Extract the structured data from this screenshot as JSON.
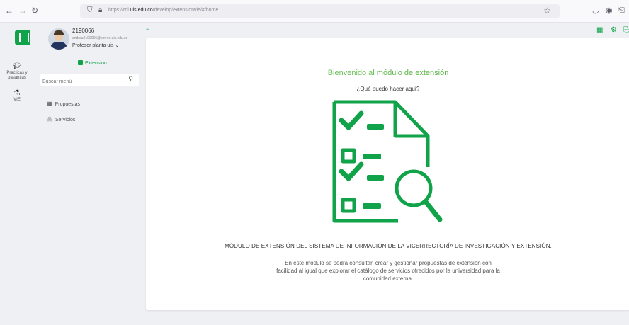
{
  "browser": {
    "url_prefix": "https://rni.",
    "url_domain": "uis.edu.co",
    "url_path": "/develop/extensionvie/#/home"
  },
  "user": {
    "id": "2190066",
    "email": "andrea2190066@correo.uis.edu.co",
    "role": "Profesor planta uis"
  },
  "rail": {
    "items": [
      {
        "label_line1": "Practicas y",
        "label_line2": "pasantias"
      },
      {
        "label_line1": "VIE"
      }
    ]
  },
  "sidebar": {
    "module_label": "Extension",
    "search_placeholder": "Buscar menú",
    "menu": [
      {
        "label": "Propuestas"
      },
      {
        "label": "Servicios"
      }
    ]
  },
  "main": {
    "welcome_prefix": "Bienvenido al ",
    "welcome_highlight": "módulo de extensión",
    "question": "¿Qué puedo hacer aquí?",
    "module_title": "MÓDULO DE EXTENSIÓN DEL SISTEMA DE INFORMACIÓN DE LA VICERRECTORÍA DE INVESTIGACIÓN Y EXTENSIÓN.",
    "description": "En este módulo se podrá consultar, crear y gestionar propuestas de extensión con facilidad al igual que explorar el catálogo de servicios ofrecidos por la universidad para la comunidad externa."
  },
  "colors": {
    "brand": "#11a34a",
    "accent_text": "#6cc05a"
  },
  "icons": [
    "back-arrow-icon",
    "forward-arrow-icon",
    "reload-icon",
    "shield-icon",
    "lock-icon",
    "bookmark-star-icon",
    "pocket-icon",
    "account-icon",
    "extensions-icon",
    "logo-icon",
    "graduation-cap-icon",
    "flask-icon",
    "search-icon",
    "grid-icon",
    "sitemap-icon",
    "menu-toggle-icon",
    "apps-grid-icon",
    "gear-icon",
    "logout-icon",
    "checklist-magnifier-illustration"
  ]
}
